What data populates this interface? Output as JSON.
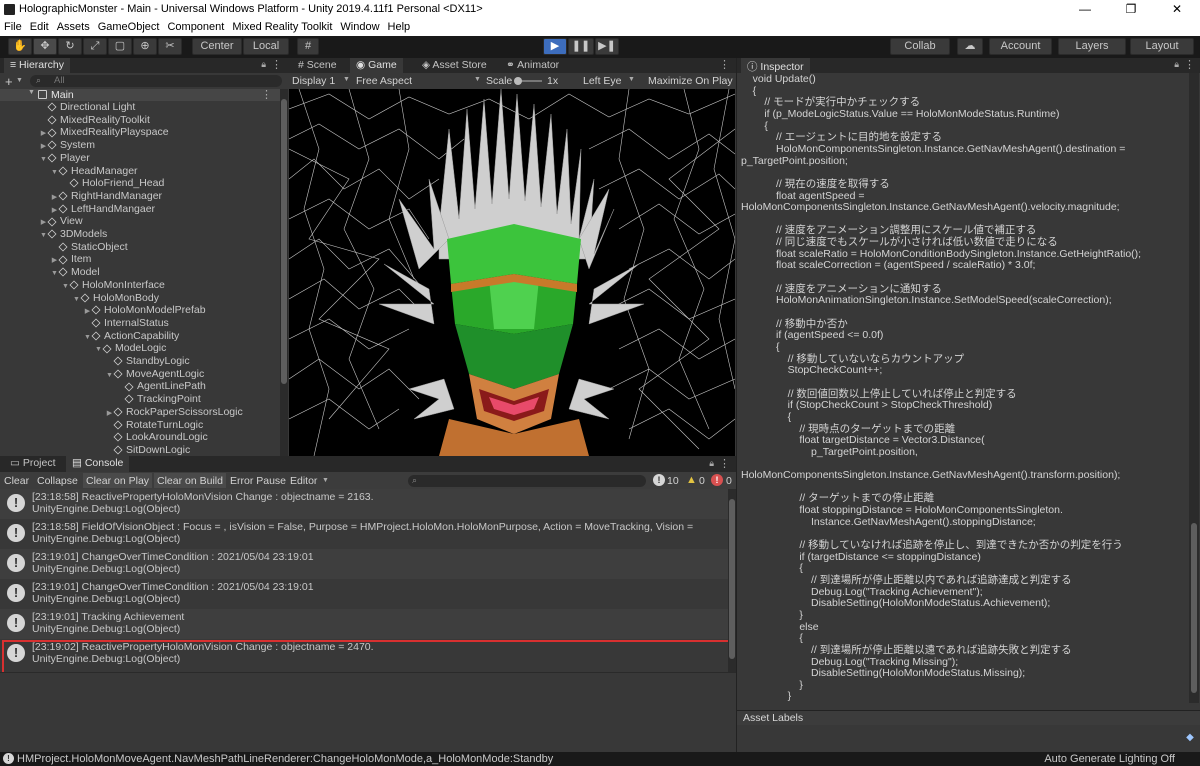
{
  "window": {
    "title": "HolographicMonster - Main - Universal Windows Platform - Unity 2019.4.11f1 Personal <DX11>",
    "minimize": "—",
    "maximize": "❐",
    "close": "✕"
  },
  "menu": [
    "File",
    "Edit",
    "Assets",
    "GameObject",
    "Component",
    "Mixed Reality Toolkit",
    "Window",
    "Help"
  ],
  "toolbar": {
    "center": "Center",
    "local": "Local",
    "collab": "Collab",
    "account": "Account",
    "layers": "Layers",
    "layout": "Layout"
  },
  "hierarchy": {
    "tab": "Hierarchy",
    "add": "+",
    "search_placeholder": "All",
    "scene": "Main",
    "rows": [
      {
        "label": "Directional Light",
        "depth": 1,
        "arrow": ""
      },
      {
        "label": "MixedRealityToolkit",
        "depth": 1,
        "arrow": ""
      },
      {
        "label": "MixedRealityPlayspace",
        "depth": 1,
        "arrow": "▶"
      },
      {
        "label": "System",
        "depth": 1,
        "arrow": "▶"
      },
      {
        "label": "Player",
        "depth": 1,
        "arrow": "▼"
      },
      {
        "label": "HeadManager",
        "depth": 2,
        "arrow": "▼"
      },
      {
        "label": "HoloFriend_Head",
        "depth": 3,
        "arrow": ""
      },
      {
        "label": "RightHandManager",
        "depth": 2,
        "arrow": "▶"
      },
      {
        "label": "LeftHandMangaer",
        "depth": 2,
        "arrow": "▶"
      },
      {
        "label": "View",
        "depth": 1,
        "arrow": "▶"
      },
      {
        "label": "3DModels",
        "depth": 1,
        "arrow": "▼"
      },
      {
        "label": "StaticObject",
        "depth": 2,
        "arrow": ""
      },
      {
        "label": "Item",
        "depth": 2,
        "arrow": "▶"
      },
      {
        "label": "Model",
        "depth": 2,
        "arrow": "▼"
      },
      {
        "label": "HoloMonInterface",
        "depth": 3,
        "arrow": "▼"
      },
      {
        "label": "HoloMonBody",
        "depth": 4,
        "arrow": "▼"
      },
      {
        "label": "HoloMonModelPrefab",
        "depth": 5,
        "arrow": "▶"
      },
      {
        "label": "InternalStatus",
        "depth": 5,
        "arrow": ""
      },
      {
        "label": "ActionCapability",
        "depth": 5,
        "arrow": "▼"
      },
      {
        "label": "ModeLogic",
        "depth": 6,
        "arrow": "▼"
      },
      {
        "label": "StandbyLogic",
        "depth": 7,
        "arrow": ""
      },
      {
        "label": "MoveAgentLogic",
        "depth": 7,
        "arrow": "▼"
      },
      {
        "label": "AgentLinePath",
        "depth": 8,
        "arrow": ""
      },
      {
        "label": "TrackingPoint",
        "depth": 8,
        "arrow": ""
      },
      {
        "label": "RockPaperScissorsLogic",
        "depth": 7,
        "arrow": "▶"
      },
      {
        "label": "RotateTurnLogic",
        "depth": 7,
        "arrow": ""
      },
      {
        "label": "LookAroundLogic",
        "depth": 7,
        "arrow": ""
      },
      {
        "label": "SitDownLogic",
        "depth": 7,
        "arrow": ""
      }
    ]
  },
  "game": {
    "tabs": [
      "Scene",
      "Game",
      "Asset Store",
      "Animator"
    ],
    "display": "Display 1",
    "aspect": "Free Aspect",
    "scale_label": "Scale",
    "scale_value": "1x",
    "eye": "Left Eye",
    "maximize": "Maximize On Play"
  },
  "console": {
    "tabs": [
      "Project",
      "Console"
    ],
    "buttons": [
      "Clear",
      "Collapse",
      "Clear on Play",
      "Clear on Build",
      "Error Pause",
      "Editor"
    ],
    "counts": {
      "log": "10",
      "warn": "0",
      "error": "0"
    },
    "entries": [
      {
        "l1": "[23:18:58] ReactivePropertyHoloMonVision Change : objectname = 2163.",
        "l2": "UnityEngine.Debug:Log(Object)"
      },
      {
        "l1": "[23:18:58] FieldOfVisionObject : Focus = , isVision = False, Purpose = HMProject.HoloMon.HoloMonPurpose, Action = MoveTracking, Vision =",
        "l2": "UnityEngine.Debug:Log(Object)"
      },
      {
        "l1": "[23:19:01] ChangeOverTimeCondition : 2021/05/04 23:19:01",
        "l2": "UnityEngine.Debug:Log(Object)"
      },
      {
        "l1": "[23:19:01] ChangeOverTimeCondition : 2021/05/04 23:19:01",
        "l2": "UnityEngine.Debug:Log(Object)"
      },
      {
        "l1": "[23:19:01] Tracking Achievement",
        "l2": "UnityEngine.Debug:Log(Object)"
      },
      {
        "l1": "[23:19:02] ReactivePropertyHoloMonVision Change : objectname = 2470.",
        "l2": "UnityEngine.Debug:Log(Object)"
      }
    ]
  },
  "inspector": {
    "tab": "Inspector",
    "asset_labels": "Asset Labels",
    "code": [
      "    void Update()",
      "    {",
      "        // モードが実行中かチェックする",
      "        if (p_ModeLogicStatus.Value == HoloMonModeStatus.Runtime)",
      "        {",
      "            // エージェントに目的地を設定する",
      "            HoloMonComponentsSingleton.Instance.GetNavMeshAgent().destination =",
      "p_TargetPoint.position;",
      "",
      "            // 現在の速度を取得する",
      "            float agentSpeed =",
      "HoloMonComponentsSingleton.Instance.GetNavMeshAgent().velocity.magnitude;",
      "",
      "            // 速度をアニメーション調整用にスケール値で補正する",
      "            // 同じ速度でもスケールが小さければ低い数値で走りになる",
      "            float scaleRatio = HoloMonConditionBodySingleton.Instance.GetHeightRatio();",
      "            float scaleCorrection = (agentSpeed / scaleRatio) * 3.0f;",
      "",
      "            // 速度をアニメーションに通知する",
      "            HoloMonAnimationSingleton.Instance.SetModelSpeed(scaleCorrection);",
      "",
      "            // 移動中か否か",
      "            if (agentSpeed <= 0.0f)",
      "            {",
      "                // 移動していないならカウントアップ",
      "                StopCheckCount++;",
      "",
      "                // 数回値回数以上停止していれば停止と判定する",
      "                if (StopCheckCount > StopCheckThreshold)",
      "                {",
      "                    // 現時点のターゲットまでの距離",
      "                    float targetDistance = Vector3.Distance(",
      "                        p_TargetPoint.position,",
      "",
      "HoloMonComponentsSingleton.Instance.GetNavMeshAgent().transform.position);",
      "",
      "                    // ターゲットまでの停止距離",
      "                    float stoppingDistance = HoloMonComponentsSingleton.",
      "                        Instance.GetNavMeshAgent().stoppingDistance;",
      "",
      "                    // 移動していなければ追跡を停止し、到達できたか否かの判定を行う",
      "                    if (targetDistance <= stoppingDistance)",
      "                    {",
      "                        // 到達場所が停止距離以内であれば追跡達成と判定する",
      "                        Debug.Log(\"Tracking Achievement\");",
      "                        DisableSetting(HoloMonModeStatus.Achievement);",
      "                    }",
      "                    else",
      "                    {",
      "                        // 到達場所が停止距離以遠であれば追跡失敗と判定する",
      "                        Debug.Log(\"Tracking Missing\");",
      "                        DisableSetting(HoloMonModeStatus.Missing);",
      "                    }",
      "                }",
      "            }"
    ]
  },
  "status": {
    "message": "HMProject.HoloMonMoveAgent.NavMeshPathLineRenderer:ChangeHoloMonMode,a_HoloMonMode:Standby",
    "right": "Auto Generate Lighting Off"
  },
  "colors": {
    "highlight_border": "#d83030",
    "play_button": "#3d6dbd"
  }
}
